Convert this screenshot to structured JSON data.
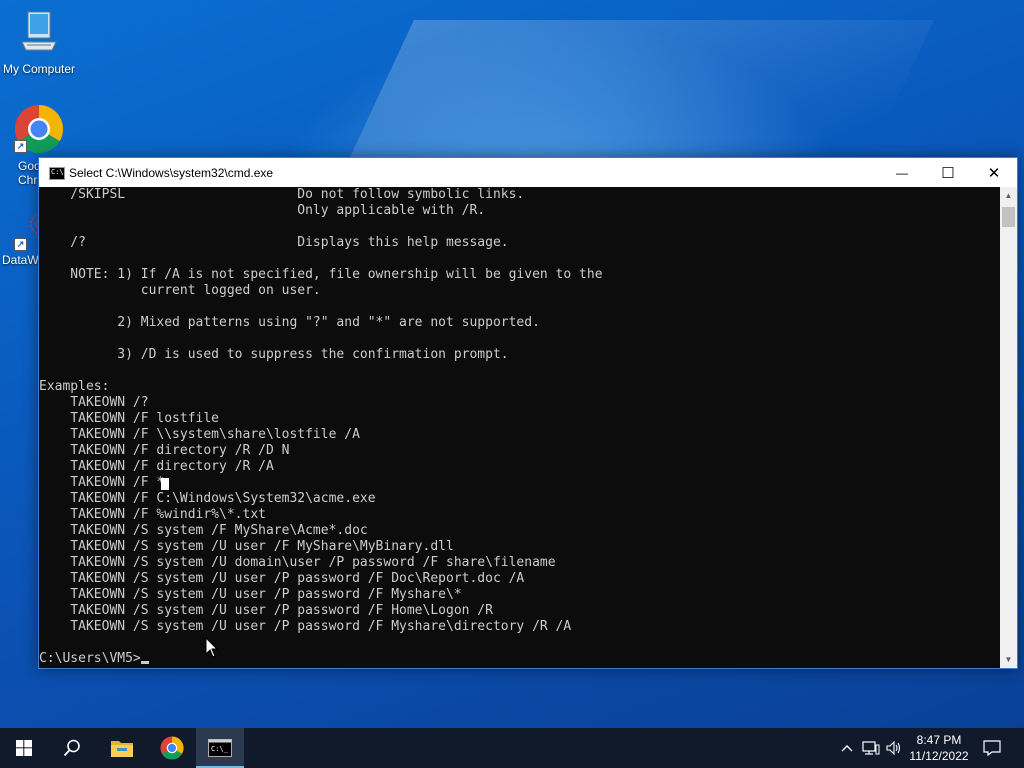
{
  "desktop": {
    "icons": [
      {
        "label": "My Computer",
        "icon": "computer-icon"
      },
      {
        "label": "Goo Chr",
        "line1": "Goo",
        "line2": "Chr",
        "icon": "chrome-icon"
      },
      {
        "label": "DataW",
        "icon": "datawrapper-icon"
      }
    ]
  },
  "window": {
    "title": "Select C:\\Windows\\system32\\cmd.exe",
    "minimize_glyph": "—",
    "maximize_glyph": "☐",
    "close_glyph": "✕",
    "console_lines": [
      "    /SKIPSL                      Do not follow symbolic links.",
      "                                 Only applicable with /R.",
      "",
      "    /?                           Displays this help message.",
      "",
      "    NOTE: 1) If /A is not specified, file ownership will be given to the",
      "             current logged on user.",
      "",
      "          2) Mixed patterns using \"?\" and \"*\" are not supported.",
      "",
      "          3) /D is used to suppress the confirmation prompt.",
      "",
      "Examples:",
      "    TAKEOWN /?",
      "    TAKEOWN /F lostfile",
      "    TAKEOWN /F \\\\system\\share\\lostfile /A",
      "    TAKEOWN /F directory /R /D N",
      "    TAKEOWN /F directory /R /A",
      "    TAKEOWN /F *",
      "    TAKEOWN /F C:\\Windows\\System32\\acme.exe",
      "    TAKEOWN /F %windir%\\*.txt",
      "    TAKEOWN /S system /F MyShare\\Acme*.doc",
      "    TAKEOWN /S system /U user /F MyShare\\MyBinary.dll",
      "    TAKEOWN /S system /U domain\\user /P password /F share\\filename",
      "    TAKEOWN /S system /U user /P password /F Doc\\Report.doc /A",
      "    TAKEOWN /S system /U user /P password /F Myshare\\*",
      "    TAKEOWN /S system /U user /P password /F Home\\Logon /R",
      "    TAKEOWN /S system /U user /P password /F Myshare\\directory /R /A",
      ""
    ],
    "prompt": "C:\\Users\\VM5>"
  },
  "taskbar": {
    "buttons": [
      {
        "name": "start",
        "icon": "windows-logo-icon"
      },
      {
        "name": "search",
        "icon": "search-icon"
      },
      {
        "name": "file-explorer",
        "icon": "folder-icon"
      },
      {
        "name": "chrome",
        "icon": "chrome-icon"
      },
      {
        "name": "cmd",
        "icon": "cmd-icon",
        "active": true
      }
    ],
    "tray_icons": [
      "chevron-up-icon",
      "network-icon",
      "volume-icon",
      "notification-icon"
    ],
    "time": "8:47 PM",
    "date": "11/12/2022"
  },
  "colors": {
    "accent": "#76b9ed",
    "console_bg": "#0c0c0c",
    "console_text": "#cccccc",
    "taskbar_bg": "#101a2b"
  }
}
